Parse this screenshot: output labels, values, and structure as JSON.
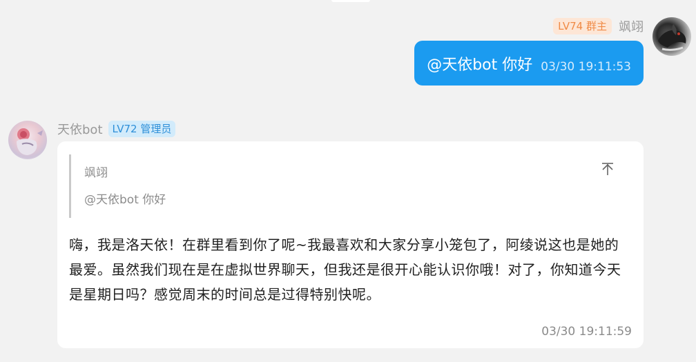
{
  "outgoing": {
    "badge": "LV74 群主",
    "sender": "飒翊",
    "text": "@天依bot 你好",
    "time": "03/30 19:11:53",
    "bubble_color": "#1b9bf0"
  },
  "incoming": {
    "sender": "天依bot",
    "badge": "LV72 管理员",
    "quote": {
      "sender": "飒翊",
      "text": "@天依bot 你好",
      "jump_icon": "arrow-to-top-icon"
    },
    "text": "嗨，我是洛天依！在群里看到你了呢~我最喜欢和大家分享小笼包了，阿绫说这也是她的最爱。虽然我们现在是在虚拟世界聊天，但我还是很开心能认识你哦！对了，你知道今天是星期日吗？感觉周末的时间总是过得特别快呢。",
    "time": "03/30 19:11:59"
  },
  "colors": {
    "background": "#f2f2f2",
    "owner_badge_bg": "#fde6d6",
    "owner_badge_text": "#f08a45",
    "admin_badge_bg": "#d2ebfb",
    "admin_badge_text": "#2e8fd8"
  }
}
